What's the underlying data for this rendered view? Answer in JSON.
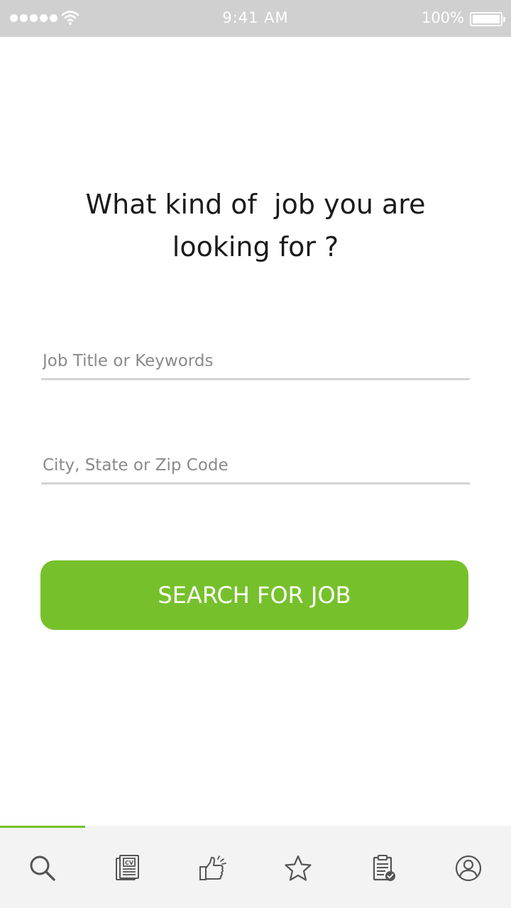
{
  "status_bar": {
    "time": "9:41 AM",
    "battery": "100%"
  },
  "headline": {
    "line1": "What kind of  job you are",
    "line2": "looking for ?"
  },
  "form": {
    "job_title_placeholder": "Job Title or Keywords",
    "location_placeholder": "City, State or Zip Code",
    "search_button_label": "SEARCH FOR JOB"
  },
  "tab_bar": {
    "active_tab": "search",
    "tabs": [
      {
        "id": "search",
        "icon": "search-icon"
      },
      {
        "id": "cv",
        "icon": "cv-document-icon",
        "icon_text": "CV"
      },
      {
        "id": "recommended",
        "icon": "thumbs-up-icon"
      },
      {
        "id": "favorites",
        "icon": "star-icon"
      },
      {
        "id": "applications",
        "icon": "clipboard-check-icon"
      },
      {
        "id": "profile",
        "icon": "profile-icon"
      }
    ]
  },
  "colors": {
    "accent": "#76c12b",
    "status_bar": "#d0d0d0",
    "tab_bar": "#f3f3f3",
    "icon": "#555555"
  }
}
